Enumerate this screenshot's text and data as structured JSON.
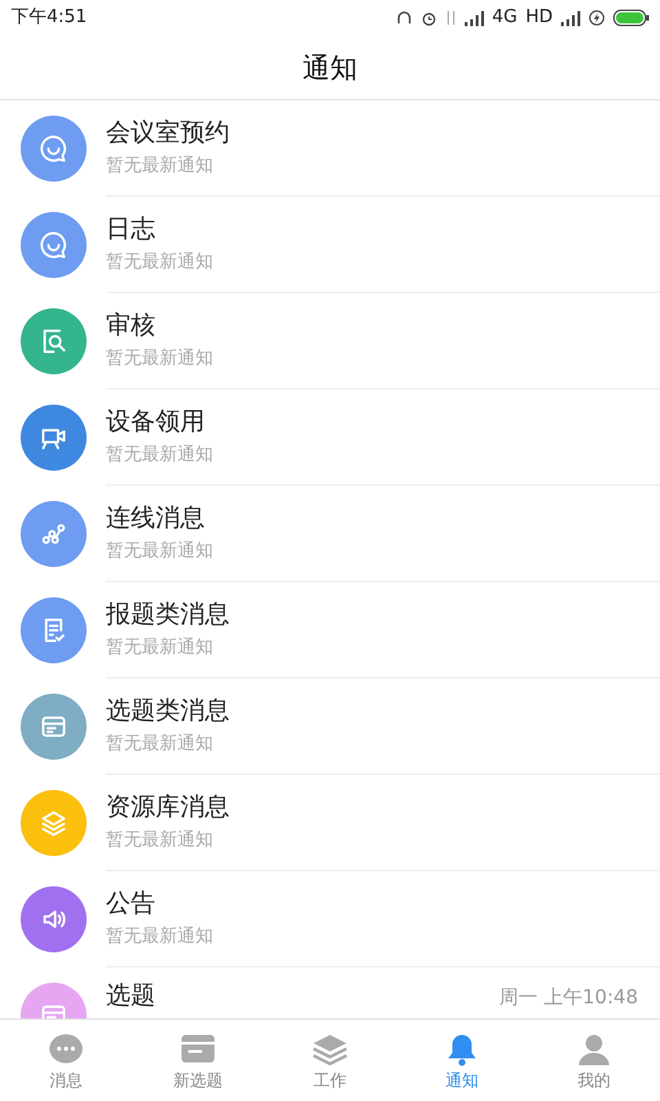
{
  "status_bar": {
    "time": "下午4:51",
    "network": "4G",
    "hd": "HD"
  },
  "header": {
    "title": "通知"
  },
  "notifications": [
    {
      "kind": "chat",
      "color": "#6e9cf0",
      "title": "会议室预约",
      "subtitle": "暂无最新通知"
    },
    {
      "kind": "chat",
      "color": "#6e9cf0",
      "title": "日志",
      "subtitle": "暂无最新通知"
    },
    {
      "kind": "review",
      "color": "#35b58e",
      "title": "审核",
      "subtitle": "暂无最新通知"
    },
    {
      "kind": "camera",
      "color": "#3f88e0",
      "title": "设备领用",
      "subtitle": "暂无最新通知"
    },
    {
      "kind": "nodes",
      "color": "#6e9cf0",
      "title": "连线消息",
      "subtitle": "暂无最新通知"
    },
    {
      "kind": "list",
      "color": "#6e9cf0",
      "title": "报题类消息",
      "subtitle": "暂无最新通知"
    },
    {
      "kind": "card",
      "color": "#7eadc4",
      "title": "选题类消息",
      "subtitle": "暂无最新通知"
    },
    {
      "kind": "layers",
      "color": "#fbbf0e",
      "title": "资源库消息",
      "subtitle": "暂无最新通知"
    },
    {
      "kind": "speaker",
      "color": "#a070ee",
      "title": "公告",
      "subtitle": "暂无最新通知"
    },
    {
      "kind": "card",
      "color": "#e6a6f2",
      "title": "选题",
      "time": "周一 上午10:48"
    }
  ],
  "tab_bar": [
    {
      "kind": "chat",
      "label": "消息",
      "selected": false
    },
    {
      "kind": "card",
      "label": "新选题",
      "selected": false
    },
    {
      "kind": "layers",
      "label": "工作",
      "selected": false
    },
    {
      "kind": "bell",
      "label": "通知",
      "selected": true
    },
    {
      "kind": "person",
      "label": "我的",
      "selected": false
    }
  ]
}
